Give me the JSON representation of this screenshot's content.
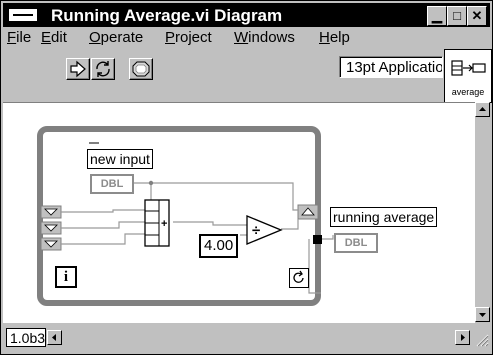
{
  "window": {
    "title": "Running Average.vi Diagram"
  },
  "window_buttons": {
    "minimize": "▁",
    "maximize": "□",
    "close": "✕"
  },
  "menu": [
    "File",
    "Edit",
    "Operate",
    "Project",
    "Windows",
    "Help"
  ],
  "toolbar": {
    "font": "13pt Application Font"
  },
  "vi_icon": {
    "caption": "average"
  },
  "diagram": {
    "input_label": "new input",
    "input_type": "DBL",
    "constant": "4.00",
    "output_label": "running average",
    "output_type": "DBL",
    "iteration_terminal": "i",
    "add_symbol": "+",
    "divide_symbol": "÷"
  },
  "status": {
    "version": "1.0b3"
  }
}
